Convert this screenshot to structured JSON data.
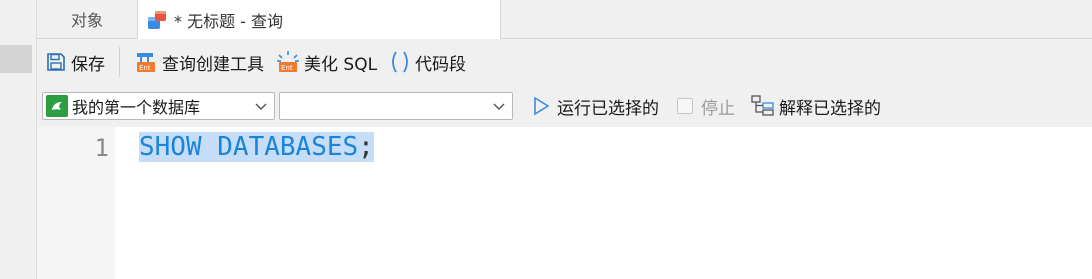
{
  "tabs": [
    {
      "label": "对象",
      "active": false
    },
    {
      "label": "* 无标题 - 查询",
      "active": true
    }
  ],
  "toolbar": {
    "save": "保存",
    "query_builder": "查询创建工具",
    "beautify": "美化 SQL",
    "snippet": "代码段"
  },
  "connection": {
    "database": "我的第一个数据库",
    "schema": "",
    "run_selected": "运行已选择的",
    "stop": "停止",
    "explain_selected": "解释已选择的"
  },
  "editor": {
    "line_number": "1",
    "keyword1": "SHOW",
    "keyword2": "DATABASES",
    "terminator": ";"
  },
  "colors": {
    "keyword": "#1b84d8",
    "selection": "#c6ddf7",
    "db_icon": "#2e9e43"
  }
}
